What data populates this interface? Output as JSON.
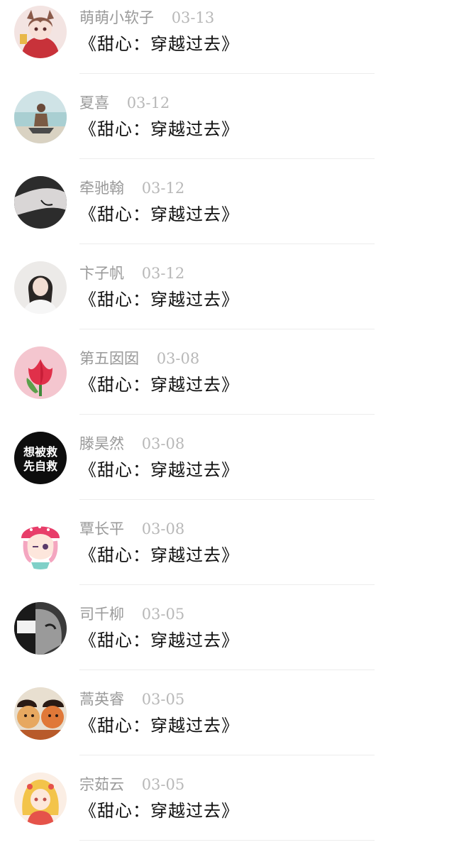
{
  "comments": [
    {
      "name": "萌萌小软子",
      "date": "03-13",
      "title": "《甜心：穿越过去》",
      "avatar_icon": "anime-girl-red-avatar"
    },
    {
      "name": "夏喜",
      "date": "03-12",
      "title": "《甜心：穿越过去》",
      "avatar_icon": "man-sitting-beach-avatar"
    },
    {
      "name": "牵驰翰",
      "date": "03-12",
      "title": "《甜心：穿越过去》",
      "avatar_icon": "hand-bracelet-avatar"
    },
    {
      "name": "卞子帆",
      "date": "03-12",
      "title": "《甜心：穿越过去》",
      "avatar_icon": "girl-portrait-avatar"
    },
    {
      "name": "第五囡囡",
      "date": "03-08",
      "title": "《甜心：穿越过去》",
      "avatar_icon": "pink-tulip-avatar"
    },
    {
      "name": "滕昊然",
      "date": "03-08",
      "title": "《甜心：穿越过去》",
      "avatar_icon": "text-badge-avatar",
      "avatar_text": [
        "想被救",
        "先自救"
      ]
    },
    {
      "name": "覃长平",
      "date": "03-08",
      "title": "《甜心：穿越过去》",
      "avatar_icon": "cartoon-girl-pink-cap-avatar"
    },
    {
      "name": "司千柳",
      "date": "03-05",
      "title": "《甜心：穿越过去》",
      "avatar_icon": "monochrome-portrait-avatar"
    },
    {
      "name": "蒿英睿",
      "date": "03-05",
      "title": "《甜心：穿越过去》",
      "avatar_icon": "cartoon-couple-avatar"
    },
    {
      "name": "宗茹云",
      "date": "03-05",
      "title": "《甜心：穿越过去》",
      "avatar_icon": "anime-blonde-girl-avatar"
    }
  ]
}
